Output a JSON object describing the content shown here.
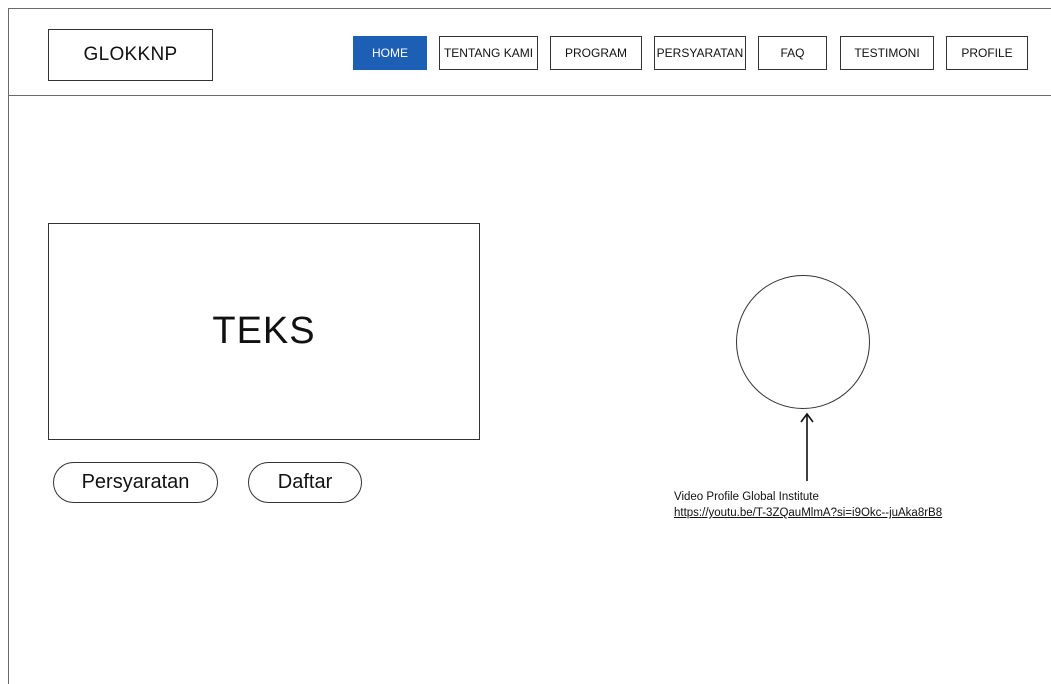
{
  "header": {
    "logo": "GLOKKNP",
    "nav": [
      {
        "label": "HOME",
        "active": true
      },
      {
        "label": "TENTANG KAMI",
        "active": false
      },
      {
        "label": "PROGRAM",
        "active": false
      },
      {
        "label": "PERSYARATAN",
        "active": false
      },
      {
        "label": "FAQ",
        "active": false
      },
      {
        "label": "TESTIMONI",
        "active": false
      },
      {
        "label": "PROFILE",
        "active": false
      }
    ]
  },
  "hero": {
    "text_placeholder": "TEKS",
    "buttons": {
      "requirements": "Persyaratan",
      "register": "Daftar"
    }
  },
  "video": {
    "title": "Video Profile Global Institute",
    "url": "https://youtu.be/T-3ZQauMlmA?si=i9Okc--juAka8rB8"
  },
  "colors": {
    "accent": "#1d5fb5",
    "border": "#333333",
    "background": "#ffffff"
  }
}
